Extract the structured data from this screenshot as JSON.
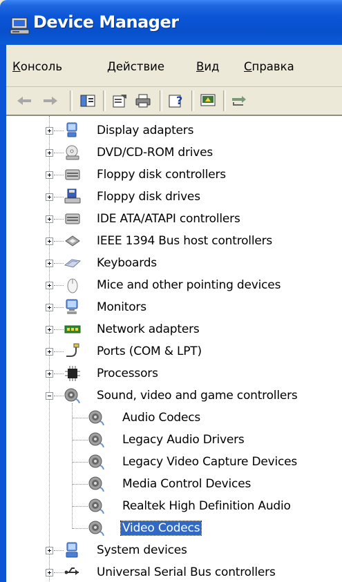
{
  "window": {
    "title": "Device Manager"
  },
  "menu": [
    {
      "label": "Консоль"
    },
    {
      "label": "Действие"
    },
    {
      "label": "Вид"
    },
    {
      "label": "Справка"
    }
  ],
  "toolbar": {
    "buttons": [
      "back-arrow",
      "forward-arrow",
      "show-hide-console-tree",
      "properties",
      "print",
      "help",
      "scan-hardware",
      "network"
    ]
  },
  "tree": {
    "items": [
      {
        "label": "Display adapters",
        "icon": "display-adapter-icon",
        "expanded": false
      },
      {
        "label": "DVD/CD-ROM drives",
        "icon": "cd-drive-icon",
        "expanded": false
      },
      {
        "label": "Floppy disk controllers",
        "icon": "controller-icon",
        "expanded": false
      },
      {
        "label": "Floppy disk drives",
        "icon": "floppy-drive-icon",
        "expanded": false
      },
      {
        "label": "IDE ATA/ATAPI controllers",
        "icon": "controller-icon",
        "expanded": false
      },
      {
        "label": "IEEE 1394 Bus host controllers",
        "icon": "firewire-icon",
        "expanded": false
      },
      {
        "label": "Keyboards",
        "icon": "keyboard-icon",
        "expanded": false
      },
      {
        "label": "Mice and other pointing devices",
        "icon": "mouse-icon",
        "expanded": false
      },
      {
        "label": "Monitors",
        "icon": "monitor-icon",
        "expanded": false
      },
      {
        "label": "Network adapters",
        "icon": "network-adapter-icon",
        "expanded": false
      },
      {
        "label": "Ports (COM & LPT)",
        "icon": "port-icon",
        "expanded": false
      },
      {
        "label": "Processors",
        "icon": "processor-icon",
        "expanded": false
      },
      {
        "label": "Sound, video and game controllers",
        "icon": "sound-icon",
        "expanded": true,
        "children": [
          {
            "label": "Audio Codecs"
          },
          {
            "label": "Legacy Audio Drivers"
          },
          {
            "label": "Legacy Video Capture Devices"
          },
          {
            "label": "Media Control Devices"
          },
          {
            "label": "Realtek High Definition Audio"
          },
          {
            "label": "Video Codecs",
            "selected": true
          }
        ]
      },
      {
        "label": "System devices",
        "icon": "system-device-icon",
        "expanded": false
      },
      {
        "label": "Universal Serial Bus controllers",
        "icon": "usb-icon",
        "expanded": false
      }
    ]
  },
  "colors": {
    "titlebar": "#0a54d6",
    "selection": "#316ac5",
    "chrome": "#ece9d8"
  }
}
